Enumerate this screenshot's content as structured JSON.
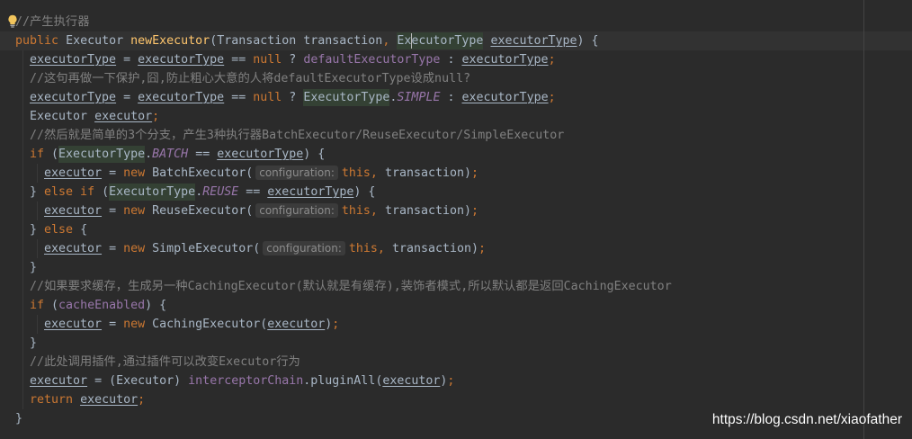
{
  "colors": {
    "editor-bg": "#2b2b2b",
    "current-line-bg": "#323232",
    "default-text": "#a9b7c6",
    "keyword": "#cc7832",
    "method-declaration": "#ffc66d",
    "field": "#9876aa",
    "comment": "#808080",
    "usage-highlight-bg": "#344134",
    "hint-bg": "#3b3b3b",
    "hint-text": "#8c8c8c",
    "caret": "#bbbbbb",
    "right-margin": "#444444",
    "indent-guide": "#393939",
    "watermark": "#ffffff"
  },
  "icons": {
    "intention": "lightbulb-icon"
  },
  "code": {
    "lines": [
      [
        "//产生执行器"
      ],
      [
        "public",
        "Executor",
        "newExecutor",
        "(Transaction transaction",
        ",",
        "ExecutorType",
        "executorType",
        ") {"
      ],
      [
        "executorType",
        "=",
        "executorType",
        "==",
        "null",
        "?",
        "defaultExecutorType",
        ":",
        "executorType",
        ";"
      ],
      [
        "//这句再做一下保护,囧,防止粗心大意的人将defaultExecutorType设成null?"
      ],
      [
        "executorType",
        "=",
        "executorType",
        "==",
        "null",
        "?",
        "ExecutorType",
        ".",
        "SIMPLE",
        ":",
        "executorType",
        ";"
      ],
      [
        "Executor",
        "executor",
        ";"
      ],
      [
        "//然后就是简单的3个分支，产生3种执行器BatchExecutor/ReuseExecutor/SimpleExecutor"
      ],
      [
        "if",
        "(",
        "ExecutorType",
        ".",
        "BATCH",
        "==",
        "executorType",
        ") {"
      ],
      [
        "executor",
        "=",
        "new",
        "BatchExecutor(",
        "configuration:",
        "this",
        ",",
        "transaction)",
        ";"
      ],
      [
        "}",
        "else if",
        "(",
        "ExecutorType",
        ".",
        "REUSE",
        "==",
        "executorType",
        ") {"
      ],
      [
        "executor",
        "=",
        "new",
        "ReuseExecutor(",
        "configuration:",
        "this",
        ",",
        "transaction)",
        ";"
      ],
      [
        "}",
        "else",
        "{"
      ],
      [
        "executor",
        "=",
        "new",
        "SimpleExecutor(",
        "configuration:",
        "this",
        ",",
        "transaction)",
        ";"
      ],
      [
        "}"
      ],
      [
        "//如果要求缓存，生成另一种CachingExecutor(默认就是有缓存),装饰者模式,所以默认都是返回CachingExecutor"
      ],
      [
        "if",
        "(",
        "cacheEnabled",
        ") {"
      ],
      [
        "executor",
        "=",
        "new",
        "CachingExecutor(",
        "executor",
        ")",
        ";"
      ],
      [
        "}"
      ],
      [
        "//此处调用插件,通过插件可以改变Executor行为"
      ],
      [
        "executor",
        "=",
        "(Executor)",
        "interceptorChain",
        ".pluginAll(",
        "executor",
        ")",
        ";"
      ],
      [
        "return",
        "executor",
        ";"
      ],
      [
        "}"
      ]
    ]
  },
  "watermark": "https://blog.csdn.net/xiaofather"
}
